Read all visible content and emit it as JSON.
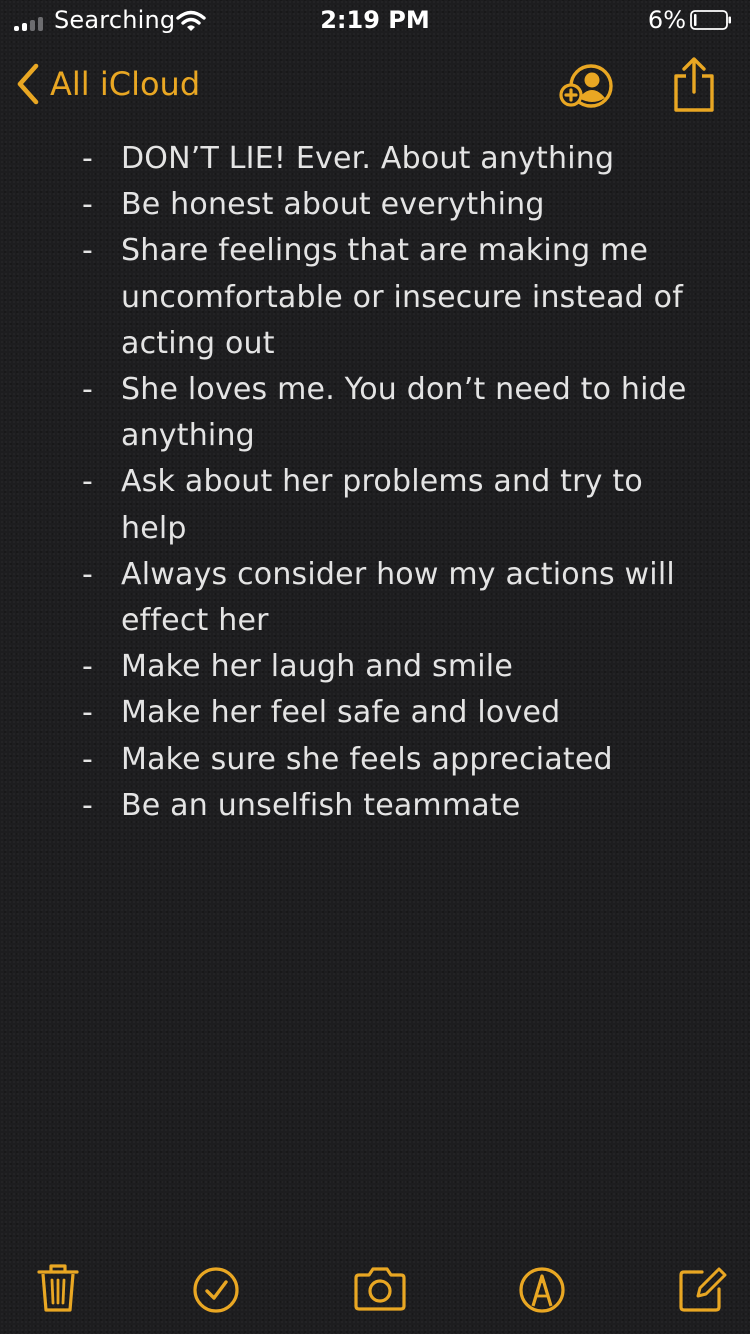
{
  "status_bar": {
    "carrier": "Searching",
    "time": "2:19 PM",
    "battery_percent": "6%",
    "battery_level": 0.06,
    "signal_bars_filled": 2,
    "signal_bars_total": 4
  },
  "nav": {
    "back_label": "All iCloud",
    "accent_color": "#e9a723"
  },
  "note": {
    "items": [
      "DON’T LIE! Ever. About anything",
      "Be honest about everything",
      "Share feelings that are making me uncomfortable or insecure instead of acting out",
      "She loves me. You don’t need to hide anything",
      "Ask about her problems and try to help",
      "Always consider how my actions will effect her",
      "Make her laugh and smile",
      "Make her feel safe and loved",
      "Make sure she feels appreciated",
      "Be an unselfish teammate"
    ],
    "bullet": "-"
  },
  "toolbar": {
    "icons": [
      "trash-icon",
      "checklist-icon",
      "camera-icon",
      "markup-icon",
      "compose-icon"
    ]
  }
}
